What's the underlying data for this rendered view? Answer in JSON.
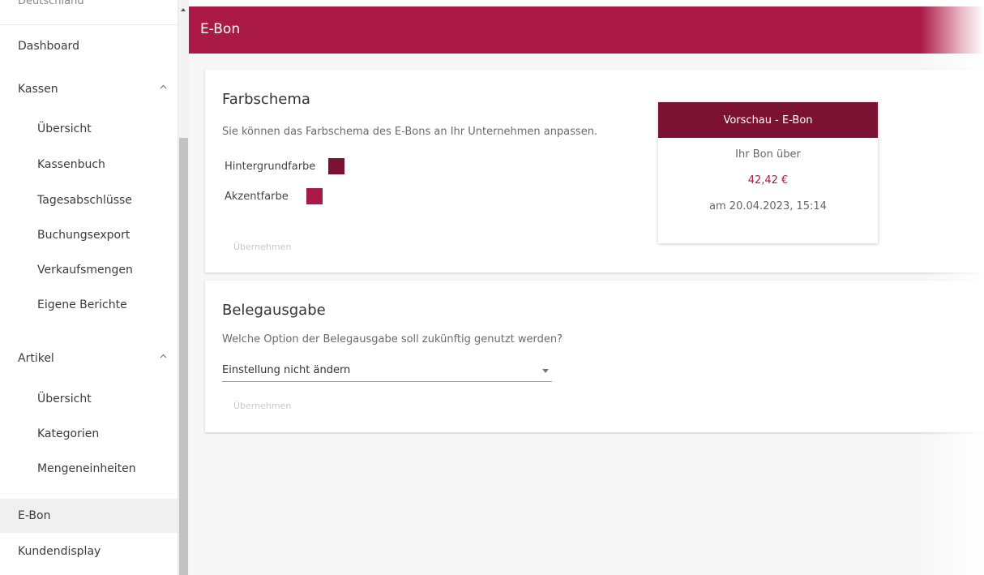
{
  "sidebar": {
    "top_cut_label": "Deutschland",
    "items": [
      {
        "label": "Dashboard"
      },
      {
        "label": "Kassen",
        "icon": "chevron-up-icon"
      },
      {
        "label": "Übersicht"
      },
      {
        "label": "Kassenbuch"
      },
      {
        "label": "Tagesabschlüsse"
      },
      {
        "label": "Buchungsexport"
      },
      {
        "label": "Verkaufsmengen"
      },
      {
        "label": "Eigene Berichte"
      },
      {
        "label": "Artikel",
        "icon": "chevron-up-icon"
      },
      {
        "label": "Übersicht"
      },
      {
        "label": "Kategorien"
      },
      {
        "label": "Mengeneinheiten"
      },
      {
        "label": "E-Bon"
      },
      {
        "label": "Kundendisplay"
      }
    ]
  },
  "header": {
    "title": "E-Bon"
  },
  "farbschema": {
    "title": "Farbschema",
    "description": "Sie können das Farbschema des E-Bons an Ihr Unternehmen anpassen.",
    "background_label": "Hintergrundfarbe",
    "background_color": "#7b1232",
    "accent_label": "Akzentfarbe",
    "accent_color": "#ab1a47",
    "apply_label": "Übernehmen"
  },
  "preview": {
    "header": "Vorschau - E-Bon",
    "line1": "Ihr Bon über",
    "amount": "42,42 €",
    "date": "am 20.04.2023, 15:14"
  },
  "belegausgabe": {
    "title": "Belegausgabe",
    "question": "Welche Option der Belegausgabe soll zukünftig genutzt werden?",
    "selected": "Einstellung nicht ändern",
    "apply_label": "Übernehmen"
  },
  "colors": {
    "brand": "#ab1a47",
    "brand_dark": "#7b1232"
  }
}
